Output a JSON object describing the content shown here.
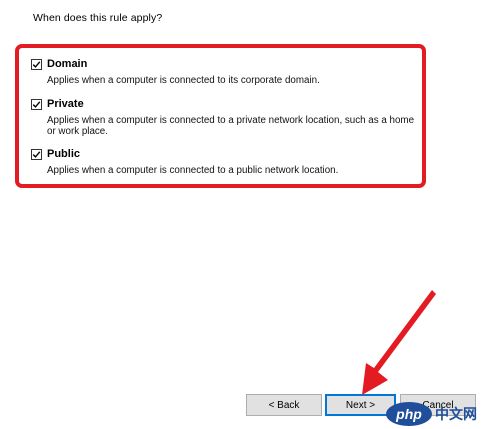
{
  "question": "When does this rule apply?",
  "options": [
    {
      "label": "Domain",
      "desc": "Applies when a computer is connected to its corporate domain.",
      "checked": true
    },
    {
      "label": "Private",
      "desc": "Applies when a computer is connected to a private network location, such as a home or work place.",
      "checked": true
    },
    {
      "label": "Public",
      "desc": "Applies when a computer is connected to a public network location.",
      "checked": true
    }
  ],
  "buttons": {
    "back": "< Back",
    "next": "Next >",
    "cancel": "Cancel"
  },
  "watermark": {
    "logo": "php",
    "text": "中文网"
  },
  "colors": {
    "highlight": "#e31b23",
    "focus": "#0078d7",
    "watermark": "#1f4e9a"
  }
}
